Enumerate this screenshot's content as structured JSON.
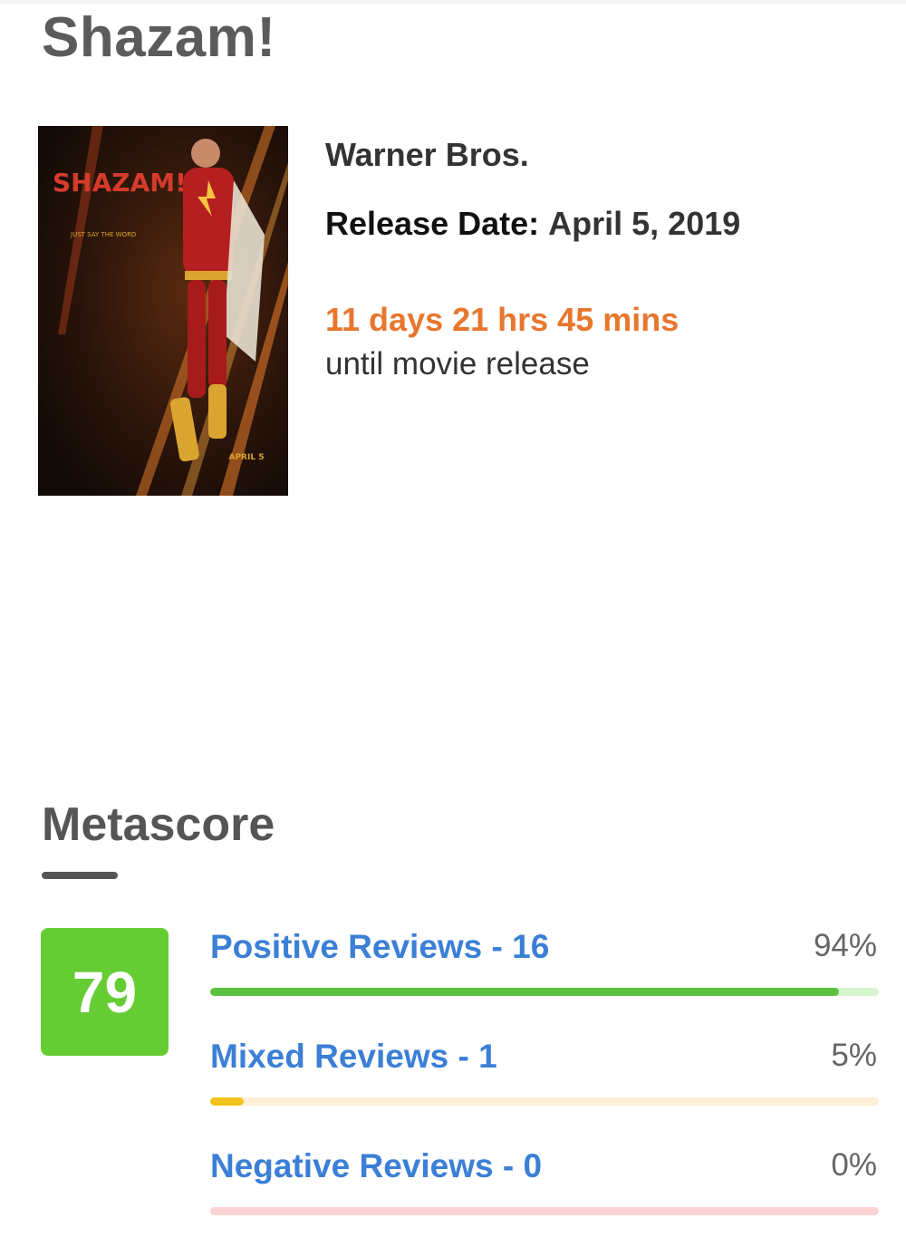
{
  "movie": {
    "title": "Shazam!",
    "studio": "Warner Bros.",
    "release_label": "Release Date:",
    "release_date": "April 5, 2019",
    "countdown": "11 days 21 hrs 45 mins",
    "countdown_suffix": "until movie release",
    "poster": {
      "title_text": "SHAZAM!",
      "tagline": "JUST SAY THE WORD",
      "date_text": "APRIL 5"
    }
  },
  "metascore": {
    "heading": "Metascore",
    "score": "79",
    "score_color": "#66cc33",
    "reviews": [
      {
        "label": "Positive Reviews - 16",
        "percent_text": "94%",
        "fraction": 0.94,
        "bar_color": "#5cc23f",
        "track_color": "#d6f5cf"
      },
      {
        "label": "Mixed Reviews - 1",
        "percent_text": "5%",
        "fraction": 0.05,
        "bar_color": "#f2c21c",
        "track_color": "#fdf0d6"
      },
      {
        "label": "Negative Reviews - 0",
        "percent_text": "0%",
        "fraction": 0.0,
        "bar_color": "#f06262",
        "track_color": "#fbd3d3"
      }
    ]
  },
  "colors": {
    "link_blue": "#3b7fd6",
    "countdown_orange": "#e8772e"
  }
}
